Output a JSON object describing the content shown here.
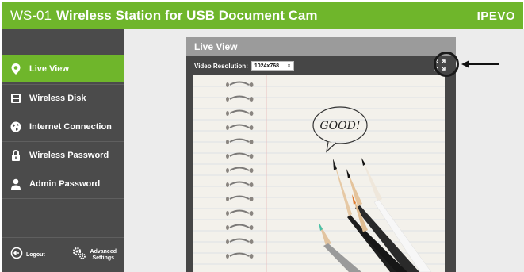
{
  "header": {
    "model": "WS-01",
    "title": "Wireless Station for USB Document Cam",
    "brand": "IPEVO"
  },
  "sidebar": {
    "items": [
      {
        "label": "Live View",
        "icon": "location-pin-icon",
        "active": true
      },
      {
        "label": "Wireless Disk",
        "icon": "disk-icon",
        "active": false
      },
      {
        "label": "Internet Connection",
        "icon": "globe-icon",
        "active": false
      },
      {
        "label": "Wireless Password",
        "icon": "lock-icon",
        "active": false
      },
      {
        "label": "Admin Password",
        "icon": "user-icon",
        "active": false
      }
    ],
    "logout_label": "Logout",
    "advanced_label_line1": "Advanced",
    "advanced_label_line2": "Settings"
  },
  "panel": {
    "title": "Live View",
    "resolution_label": "Video Resolution:",
    "resolution_value": "1024x768"
  },
  "video": {
    "handwritten_text": "GOOD!"
  },
  "colors": {
    "accent": "#6fb62b",
    "sidebar_bg": "#4b4b4b",
    "panel_bg": "#464646",
    "panel_header": "#9b9b9b",
    "main_bg": "#ececec"
  }
}
